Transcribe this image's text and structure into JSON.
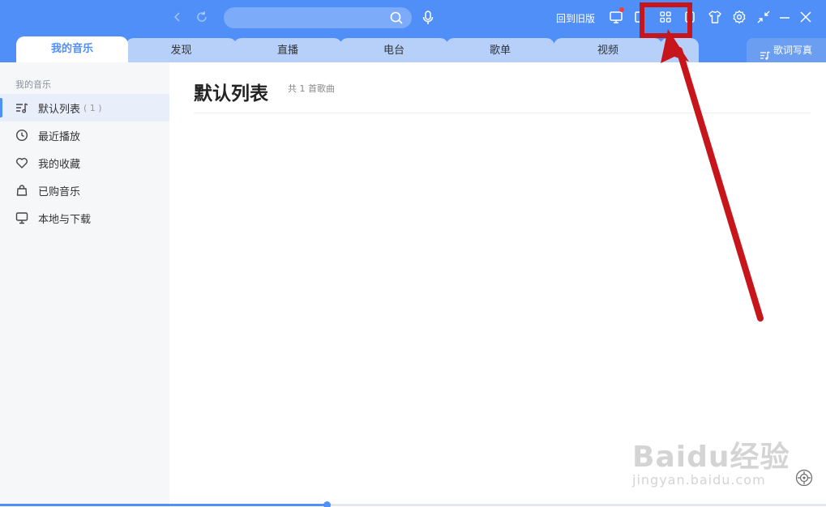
{
  "header": {
    "search_placeholder": "",
    "old_version_label": "回到旧版",
    "icons": [
      "back-arrow-icon",
      "refresh-icon",
      "search-icon",
      "mic-icon",
      "monitor-icon",
      "mini-player-icon",
      "apps-grid-icon",
      "screen-icon",
      "skin-tshirt-icon",
      "gear-icon",
      "shrink-icon",
      "minimize-icon",
      "close-icon"
    ],
    "accent": "#4f8ff7",
    "notification_dot": "#ff3b30"
  },
  "tabs": [
    {
      "label": "我的音乐",
      "active": true
    },
    {
      "label": "发现",
      "active": false
    },
    {
      "label": "直播",
      "active": false
    },
    {
      "label": "电台",
      "active": false
    },
    {
      "label": "歌单",
      "active": false
    },
    {
      "label": "视频",
      "active": false
    },
    {
      "label": "",
      "active": false
    }
  ],
  "lyric_button": "歌词写真",
  "sidebar": {
    "section_title": "我的音乐",
    "items": [
      {
        "label": "默认列表",
        "count": "( 1 )",
        "icon": "playlist-icon",
        "active": true
      },
      {
        "label": "最近播放",
        "count": "",
        "icon": "clock-icon",
        "active": false
      },
      {
        "label": "我的收藏",
        "count": "",
        "icon": "heart-icon",
        "active": false
      },
      {
        "label": "已购音乐",
        "count": "",
        "icon": "shopping-bag-icon",
        "active": false
      },
      {
        "label": "本地与下载",
        "count": "",
        "icon": "monitor-icon",
        "active": false
      }
    ]
  },
  "main": {
    "title": "默认列表",
    "subtitle": "共 1 首歌曲"
  },
  "playback": {
    "progress": 0.395
  },
  "watermark": {
    "logo": "Baidu经验",
    "url": "jingyan.baidu.com"
  },
  "annotation_color": "#c7161b"
}
